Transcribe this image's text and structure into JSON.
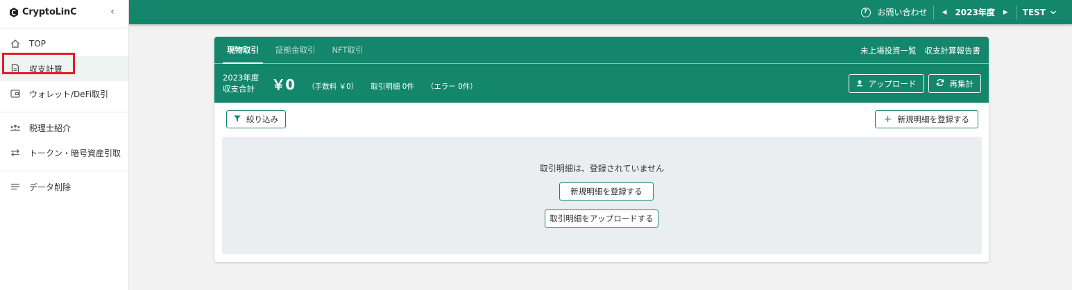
{
  "sidebar": {
    "logo_text": "CryptoLinC",
    "items": [
      {
        "label": "TOP",
        "icon": "home-icon"
      },
      {
        "label": "収支計算",
        "icon": "document-icon"
      },
      {
        "label": "ウォレット/DeFi取引",
        "icon": "wallet-icon"
      },
      {
        "label": "税理士紹介",
        "icon": "people-icon"
      },
      {
        "label": "トークン・暗号資産引取",
        "icon": "swap-icon"
      },
      {
        "label": "データ削除",
        "icon": "lines-icon"
      }
    ]
  },
  "topbar": {
    "contact_label": "お問い合わせ",
    "year_label": "2023年度",
    "user_label": "TEST"
  },
  "card": {
    "tabs": [
      {
        "label": "現物取引",
        "active": true
      },
      {
        "label": "証拠金取引",
        "active": false
      },
      {
        "label": "NFT取引",
        "active": false
      }
    ],
    "links": [
      "未上場投資一覧",
      "収支計算報告書"
    ],
    "summary": {
      "year": "2023年度",
      "label": "収支合計",
      "amount": "￥0",
      "fee": "（手数料 ￥0）",
      "count": "取引明細 0件",
      "errors": "（エラー 0件）"
    },
    "upload_label": "アップロード",
    "recalc_label": "再集計",
    "filter_label": "絞り込み",
    "add_label": "新規明細を登録する",
    "empty": {
      "message": "取引明細は、登録されていません",
      "register_label": "新規明細を登録する",
      "upload_label": "取引明細をアップロードする"
    }
  },
  "colors": {
    "brand": "#13866c",
    "highlight": "#e21c2a"
  }
}
